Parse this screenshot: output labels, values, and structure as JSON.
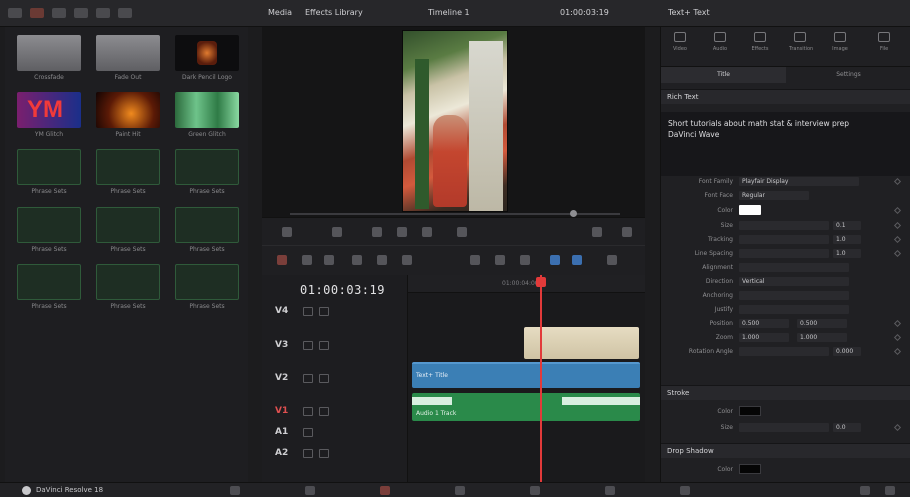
{
  "topbar": {
    "left_label": "Media",
    "middle_label": "Effects Library",
    "project_title": "Timeline 1",
    "timecode": "01:00:03:19",
    "right_label": "Text+ Text"
  },
  "media": {
    "items": [
      {
        "label": "Crossfade"
      },
      {
        "label": "Fade Out"
      },
      {
        "label": "Dark Pencil Logo"
      },
      {
        "label": "YM Glitch"
      },
      {
        "label": "Paint Hit"
      },
      {
        "label": "Green Glitch"
      },
      {
        "label": "Phrase Sets"
      },
      {
        "label": "Phrase Sets"
      },
      {
        "label": "Phrase Sets"
      },
      {
        "label": "Phrase Sets"
      },
      {
        "label": "Phrase Sets"
      },
      {
        "label": "Phrase Sets"
      },
      {
        "label": "Phrase Sets"
      },
      {
        "label": "Phrase Sets"
      },
      {
        "label": "Phrase Sets"
      }
    ]
  },
  "timeline": {
    "timecode": "01:00:03:19",
    "ruler_mark": "01:00:04:00",
    "tracks": [
      {
        "id": "V4"
      },
      {
        "id": "V3"
      },
      {
        "id": "V2"
      },
      {
        "id": "V1"
      },
      {
        "id": "A1"
      },
      {
        "id": "A2"
      }
    ],
    "clips": [
      {
        "label": "Text+ Title"
      },
      {
        "label": "Audio 1 Track"
      }
    ]
  },
  "inspector": {
    "tabs": [
      "Video",
      "Audio",
      "Effects",
      "Transition",
      "Image",
      "File"
    ],
    "subtabs": [
      "Title",
      "Settings"
    ],
    "section_text": "Rich Text",
    "text_value": "Short tutorials about math stat & interview prep",
    "subtitle_value": "DaVinci Wave",
    "rows": [
      {
        "label": "Font Family",
        "value": "Playfair Display"
      },
      {
        "label": "Font Face",
        "value": "Regular"
      },
      {
        "label": "Color",
        "value": ""
      },
      {
        "label": "Size",
        "value": "0.1"
      },
      {
        "label": "Tracking",
        "value": "1.0"
      },
      {
        "label": "Line Spacing",
        "value": "1.0"
      },
      {
        "label": "Alignment",
        "value": ""
      },
      {
        "label": "Direction",
        "value": "Vertical"
      },
      {
        "label": "Anchoring",
        "value": ""
      },
      {
        "label": "Justify",
        "value": ""
      },
      {
        "label": "Position",
        "value": "0.500"
      },
      {
        "label": "Zoom",
        "value": "1.000"
      },
      {
        "label": "Rotation Angle",
        "value": "0.000"
      }
    ],
    "section_stroke": "Stroke",
    "stroke_color_label": "Color",
    "stroke_size_label": "Size",
    "stroke_size_value": "0.0",
    "section_drop_shadow": "Drop Shadow",
    "shadow_color_label": "Color"
  },
  "status": {
    "app_name": "DaVinci Resolve 18"
  },
  "colors": {
    "accent": "#e23a3a",
    "clip_title": "#3b7fb5",
    "clip_audio": "#2a8a4a",
    "clip_cream": "#d8cdb0"
  }
}
